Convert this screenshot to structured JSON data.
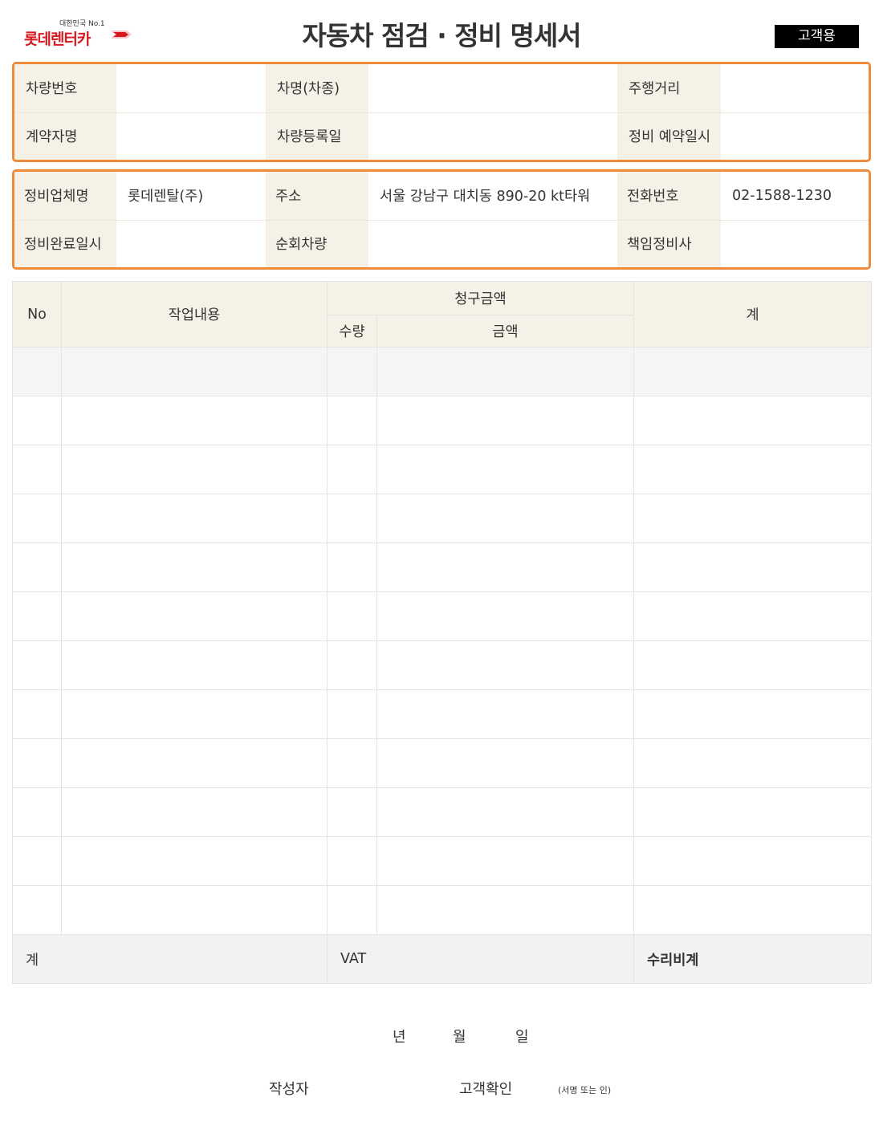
{
  "header": {
    "logo_tagline": "대한민국 No.1",
    "logo_name": "롯데렌터카",
    "title": "자동차 점검 · 정비 명세서",
    "copy_badge": "고객용",
    "brand_color": "#d7191f",
    "accent_border_color": "#ef8a3b"
  },
  "vehicle_info": {
    "row1": [
      {
        "label": "차량번호",
        "value": ""
      },
      {
        "label": "차명(차종)",
        "value": ""
      },
      {
        "label": "주행거리",
        "value": ""
      }
    ],
    "row2": [
      {
        "label": "계약자명",
        "value": ""
      },
      {
        "label": "차량등록일",
        "value": ""
      },
      {
        "label": "정비 예약일시",
        "value": ""
      }
    ]
  },
  "shop_info": {
    "row1": [
      {
        "label": "정비업체명",
        "value": "롯데렌탈(주)"
      },
      {
        "label": "주소",
        "value": "서울 강남구 대치동 890-20 kt타워"
      },
      {
        "label": "전화번호",
        "value": "02-1588-1230"
      }
    ],
    "row2": [
      {
        "label": "정비완료일시",
        "value": ""
      },
      {
        "label": "순회차량",
        "value": ""
      },
      {
        "label": "책임정비사",
        "value": ""
      }
    ]
  },
  "work_table": {
    "col_no": "No",
    "col_work": "작업내용",
    "col_billing": "청구금액",
    "col_qty": "수량",
    "col_amount": "금액",
    "col_total": "계",
    "row_count": 12,
    "summary": {
      "subtotal_label": "계",
      "vat_label": "VAT",
      "repair_total_label": "수리비계"
    }
  },
  "footer": {
    "year_label": "년",
    "month_label": "월",
    "day_label": "일",
    "writer_label": "작성자",
    "customer_confirm_label": "고객확인",
    "signature_note": "(서명 또는 인)"
  }
}
